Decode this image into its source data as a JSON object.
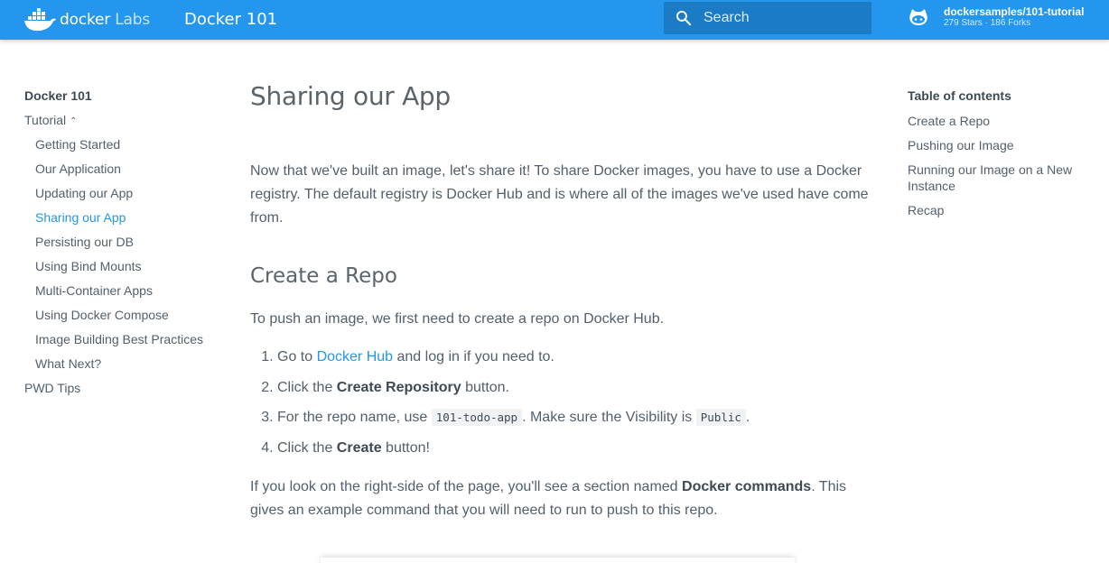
{
  "header": {
    "logo_docker": "docker",
    "logo_labs": "Labs",
    "site_title": "Docker 101",
    "search_placeholder": "Search",
    "repo_name": "dockersamples/101-tutorial",
    "repo_facts": "279 Stars · 186 Forks",
    "brand_color": "#2496ed"
  },
  "nav": {
    "title": "Docker 101",
    "section": "Tutorial",
    "items": [
      {
        "label": "Getting Started"
      },
      {
        "label": "Our Application"
      },
      {
        "label": "Updating our App"
      },
      {
        "label": "Sharing our App",
        "active": true
      },
      {
        "label": "Persisting our DB"
      },
      {
        "label": "Using Bind Mounts"
      },
      {
        "label": "Multi-Container Apps"
      },
      {
        "label": "Using Docker Compose"
      },
      {
        "label": "Image Building Best Practices"
      },
      {
        "label": "What Next?"
      }
    ],
    "bottom": "PWD Tips"
  },
  "main": {
    "title": "Sharing our App",
    "intro": "Now that we've built an image, let's share it! To share Docker images, you have to use a Docker registry. The default registry is Docker Hub and is where all of the images we've used have come from.",
    "h2": "Create a Repo",
    "para2": "To push an image, we first need to create a repo on Docker Hub.",
    "steps": {
      "s1_pre": "Go to ",
      "s1_link": "Docker Hub",
      "s1_post": " and log in if you need to.",
      "s2_pre": "Click the ",
      "s2_bold": "Create Repository",
      "s2_post": " button.",
      "s3_pre": "For the repo name, use ",
      "s3_code1": "101-todo-app",
      "s3_mid": ". Make sure the Visibility is ",
      "s3_code2": "Public",
      "s3_post": ".",
      "s4_pre": "Click the ",
      "s4_bold": "Create",
      "s4_post": " button!"
    },
    "para3_pre": "If you look on the right-side of the page, you'll see a section named ",
    "para3_bold": "Docker commands",
    "para3_post": ". This gives an example command that you will need to run to push to this repo."
  },
  "toc": {
    "title": "Table of contents",
    "items": [
      "Create a Repo",
      "Pushing our Image",
      "Running our Image on a New Instance",
      "Recap"
    ]
  }
}
